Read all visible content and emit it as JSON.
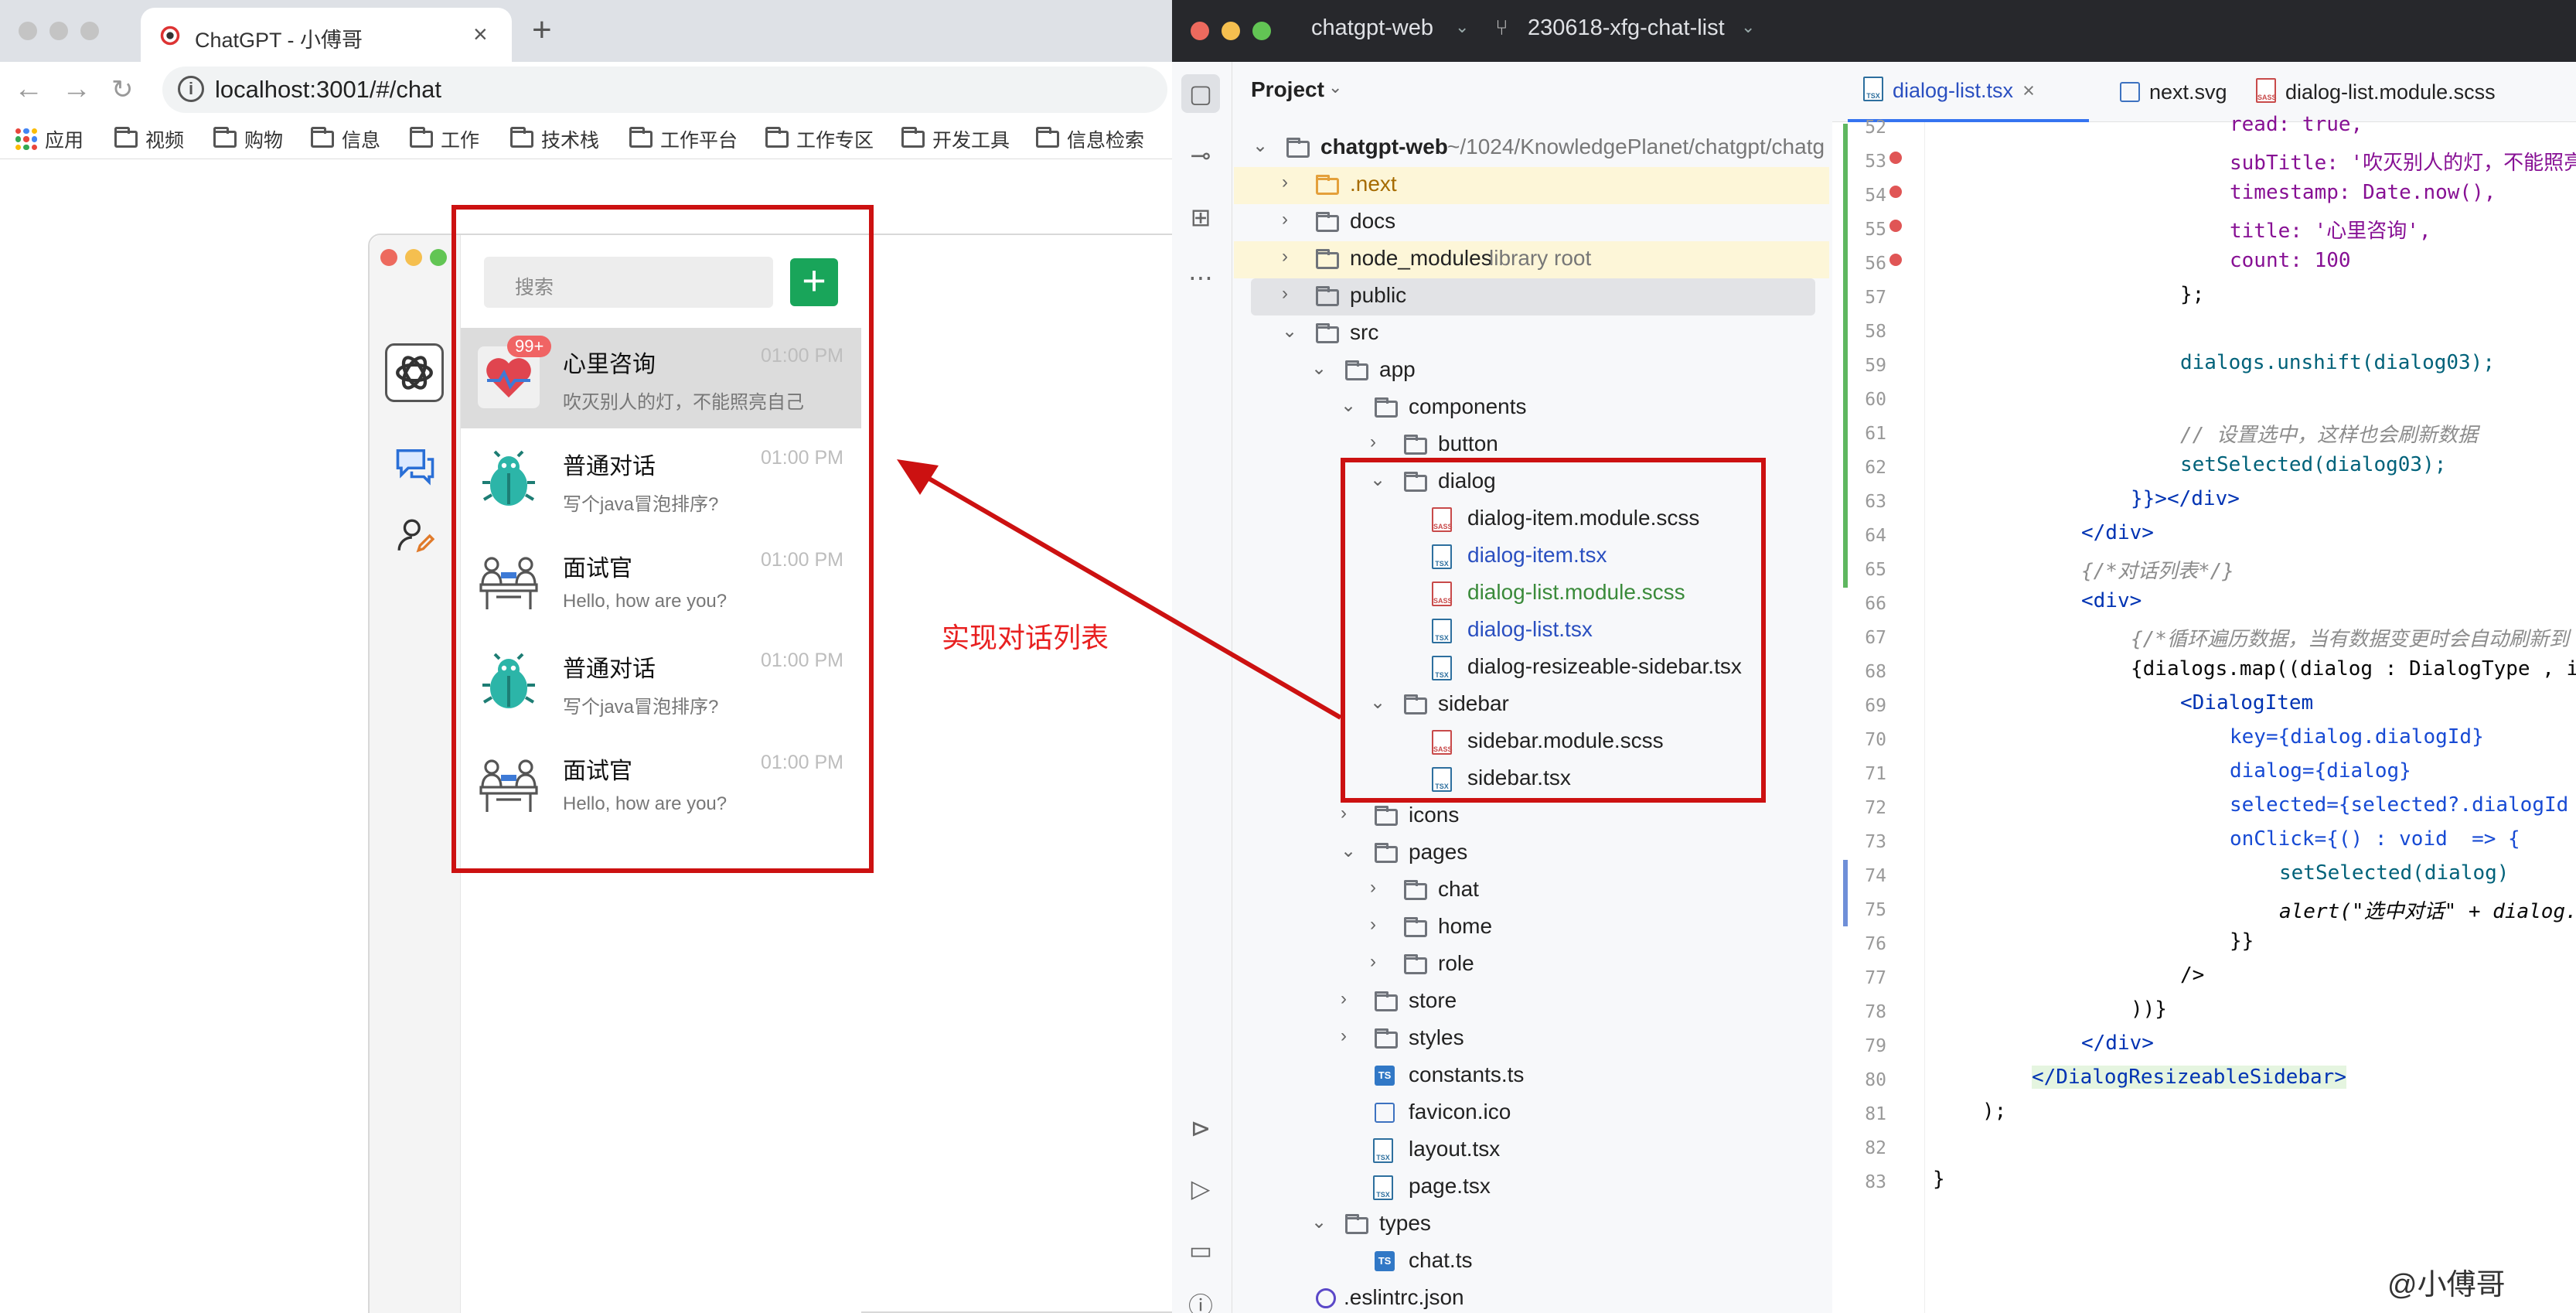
{
  "browser": {
    "tab_title": "ChatGPT - 小傅哥",
    "url": "localhost:3001/#/chat",
    "bookmarks": [
      "应用",
      "视频",
      "购物",
      "信息",
      "工作",
      "技术栈",
      "工作平台",
      "工作专区",
      "开发工具",
      "信息检索"
    ]
  },
  "chat_app": {
    "search_placeholder": "搜索",
    "add_label": "+",
    "dialogs": [
      {
        "title": "心里咨询",
        "time": "01:00 PM",
        "subtitle": "吹灭别人的灯，不能照亮自己",
        "badge": "99+"
      },
      {
        "title": "普通对话",
        "time": "01:00 PM",
        "subtitle": "写个java冒泡排序?"
      },
      {
        "title": "面试官",
        "time": "01:00 PM",
        "subtitle": "Hello, how are you?"
      },
      {
        "title": "普通对话",
        "time": "01:00 PM",
        "subtitle": "写个java冒泡排序?"
      },
      {
        "title": "面试官",
        "time": "01:00 PM",
        "subtitle": "Hello, how are you?"
      }
    ]
  },
  "annotation": "实现对话列表",
  "ide": {
    "project_name": "chatgpt-web",
    "branch": "230618-xfg-chat-list",
    "project_label": "Project",
    "tree": [
      {
        "name": "chatgpt-web",
        "extra": "~/1024/KnowledgePlanet/chatgpt/chatg"
      },
      {
        "name": ".next"
      },
      {
        "name": "docs"
      },
      {
        "name": "node_modules",
        "extra": "library root"
      },
      {
        "name": "public"
      },
      {
        "name": "src"
      },
      {
        "name": "app"
      },
      {
        "name": "components"
      },
      {
        "name": "button"
      },
      {
        "name": "dialog"
      },
      {
        "name": "dialog-item.module.scss"
      },
      {
        "name": "dialog-item.tsx"
      },
      {
        "name": "dialog-list.module.scss"
      },
      {
        "name": "dialog-list.tsx"
      },
      {
        "name": "dialog-resizeable-sidebar.tsx"
      },
      {
        "name": "sidebar"
      },
      {
        "name": "sidebar.module.scss"
      },
      {
        "name": "sidebar.tsx"
      },
      {
        "name": "icons"
      },
      {
        "name": "pages"
      },
      {
        "name": "chat"
      },
      {
        "name": "home"
      },
      {
        "name": "role"
      },
      {
        "name": "store"
      },
      {
        "name": "styles"
      },
      {
        "name": "constants.ts"
      },
      {
        "name": "favicon.ico"
      },
      {
        "name": "layout.tsx"
      },
      {
        "name": "page.tsx"
      },
      {
        "name": "types"
      },
      {
        "name": "chat.ts"
      },
      {
        "name": ".eslintrc.json"
      }
    ],
    "tabs": [
      "dialog-list.tsx",
      "next.svg",
      "dialog-list.module.scss"
    ],
    "line_numbers": [
      "52",
      "53",
      "54",
      "55",
      "56",
      "57",
      "58",
      "59",
      "60",
      "61",
      "62",
      "63",
      "64",
      "65",
      "66",
      "67",
      "68",
      "69",
      "70",
      "71",
      "72",
      "73",
      "74",
      "75",
      "76",
      "77",
      "78",
      "79",
      "80",
      "81",
      "82",
      "83"
    ],
    "code": [
      "read: true,",
      "subTitle: '吹灭别人的灯，不能照亮",
      "timestamp: Date.now(),",
      "title: '心里咨询',",
      "count: 100",
      "};",
      "",
      "dialogs.unshift(dialog03);",
      "",
      "// 设置选中，这样也会刷新数据",
      "setSelected(dialog03);",
      "}}></div>",
      "</div>",
      "{/*对话列表*/}",
      "<div>",
      "{/*循环遍历数据，当有数据变更时会自动刷新到",
      "{dialogs.map((dialog : DialogType , inc",
      "<DialogItem",
      "key={dialog.dialogId}",
      "dialog={dialog}",
      "selected={selected?.dialogId",
      "onClick={() : void  => {",
      "setSelected(dialog)",
      "alert(\"选中对话\" + dialog.",
      "}}",
      "/>",
      "))}",
      "</div>",
      "</DialogResizeableSidebar>",
      ");",
      "",
      "}"
    ]
  },
  "watermark": "@小傅哥"
}
